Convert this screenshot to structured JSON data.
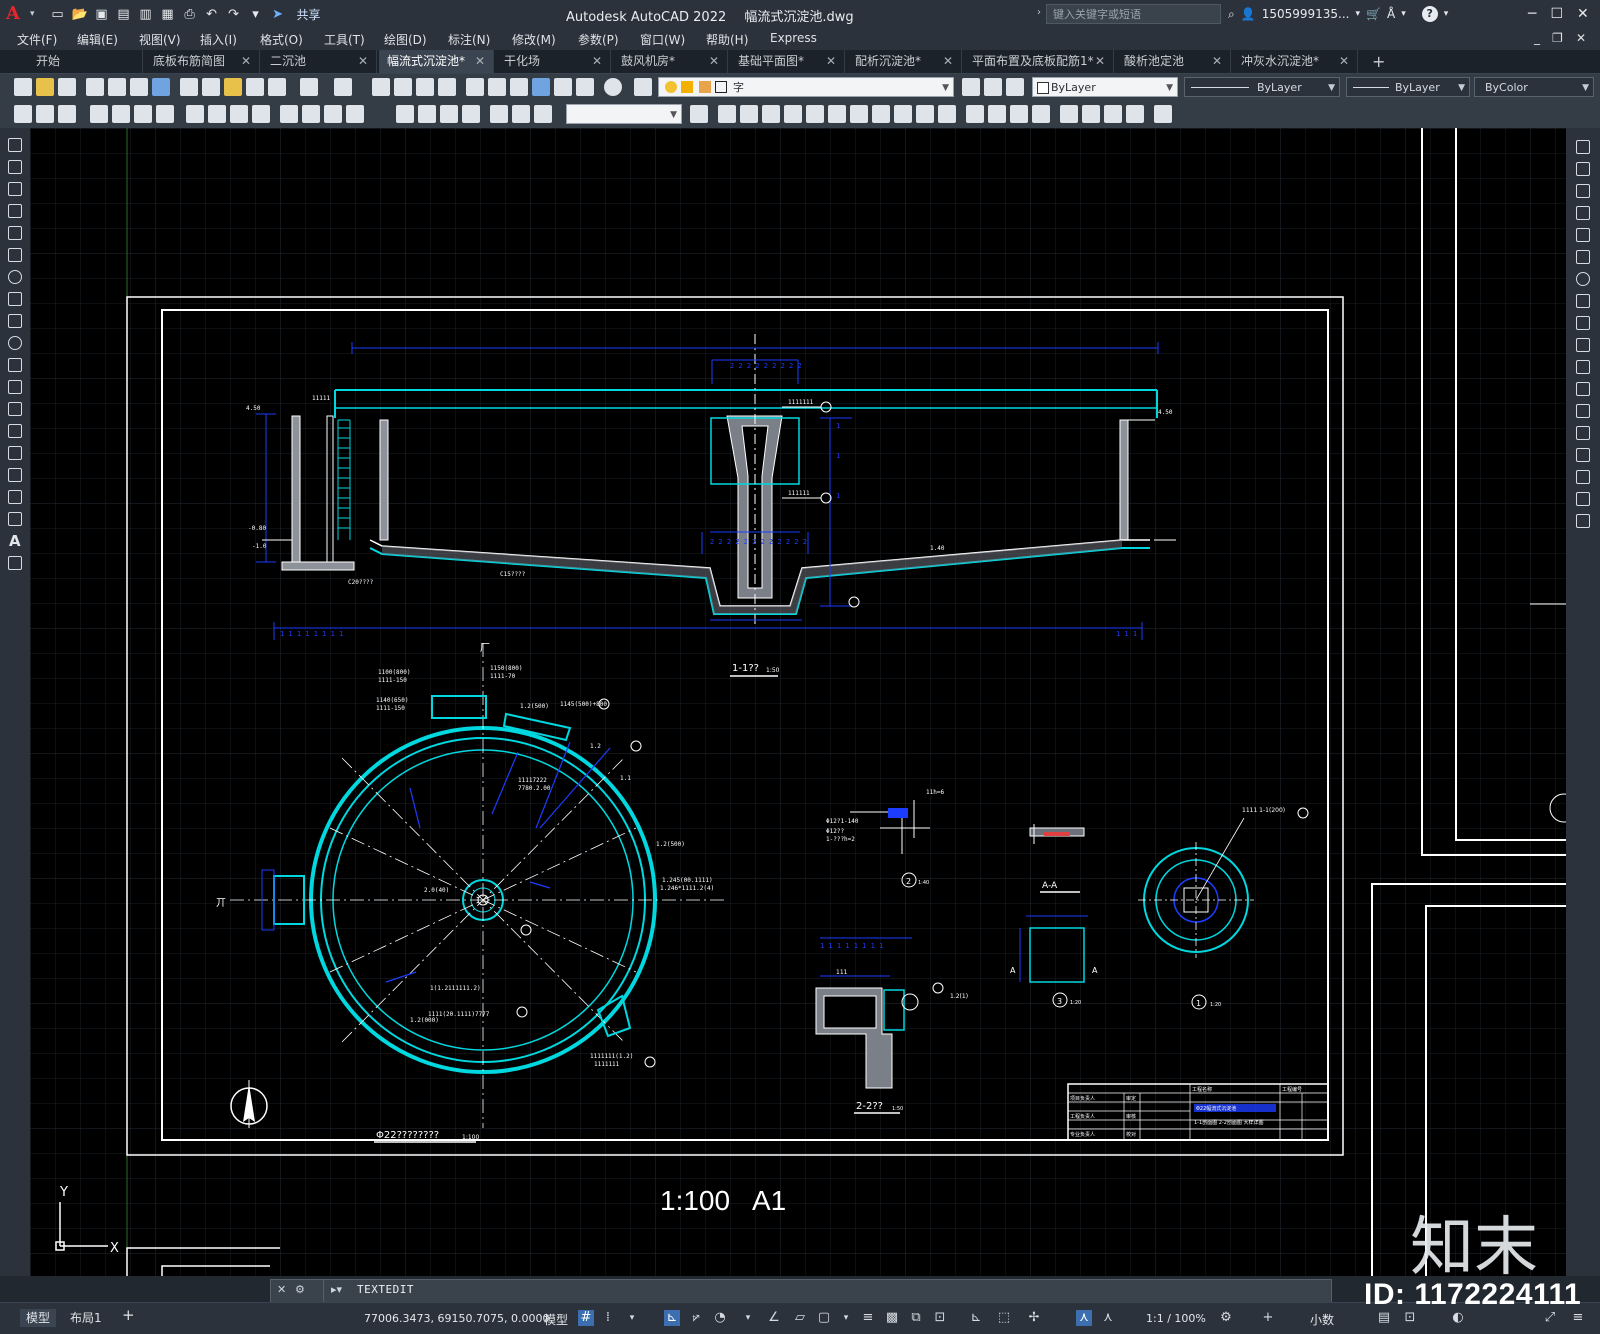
{
  "app": {
    "title": "Autodesk AutoCAD 2022",
    "file": "幅流式沉淀池.dwg",
    "share": "共享",
    "search_placeholder": "键入关键字或短语",
    "user": "1505999135..."
  },
  "menus": [
    "文件(F)",
    "编辑(E)",
    "视图(V)",
    "插入(I)",
    "格式(O)",
    "工具(T)",
    "绘图(D)",
    "标注(N)",
    "修改(M)",
    "参数(P)",
    "窗口(W)",
    "帮助(H)",
    "Express"
  ],
  "tabs": [
    {
      "label": "开始"
    },
    {
      "label": "底板布筋简图"
    },
    {
      "label": "二沉池"
    },
    {
      "label": "幅流式沉淀池*"
    },
    {
      "label": "干化场"
    },
    {
      "label": "鼓风机房*"
    },
    {
      "label": "基础平面图*"
    },
    {
      "label": "配析沉淀池*"
    },
    {
      "label": "平面布置及底板配筋1*"
    },
    {
      "label": "酸析池定池"
    },
    {
      "label": "冲灰水沉淀池*"
    }
  ],
  "toolbar": {
    "textstyle": "字",
    "layer1": "ByLayer",
    "layer2": "ByLayer",
    "layer3": "ByLayer",
    "color": "ByColor"
  },
  "drawing": {
    "section_title": "1-1??",
    "section_scale": "1:50",
    "plan_title": "Φ22????????",
    "plan_scale": "1:100",
    "detail2_title": "2-2??",
    "detail1_mark": "1",
    "detail2_mark": "2",
    "detail3_mark": "3",
    "aa_label": "A-A",
    "scale_text": "1:100",
    "sheet_size": "A1",
    "titleblock": {
      "project": "工程名称",
      "drawing_no": "工程编号",
      "rows": [
        "项目负责人",
        "审定",
        "工程负责人",
        "审核",
        "专业负责人",
        "校对"
      ],
      "drawing_name": "Φ22幅流式沉淀池",
      "sub": "1-1剖面图 2-2剖面图 大样详图"
    }
  },
  "command": {
    "text": "TEXTEDIT"
  },
  "status": {
    "coords": "77006.3473, 69150.7075, 0.0000",
    "model_label": "模型",
    "layout_tabs": [
      "模型",
      "布局1"
    ],
    "zoom": "1:1 / 100%",
    "units": "小数"
  },
  "watermark": {
    "brand": "知末",
    "id": "ID: 1172224111"
  },
  "colors": {
    "cyan": "#00d8e0",
    "blue": "#1c3cff",
    "white": "#ffffff"
  }
}
